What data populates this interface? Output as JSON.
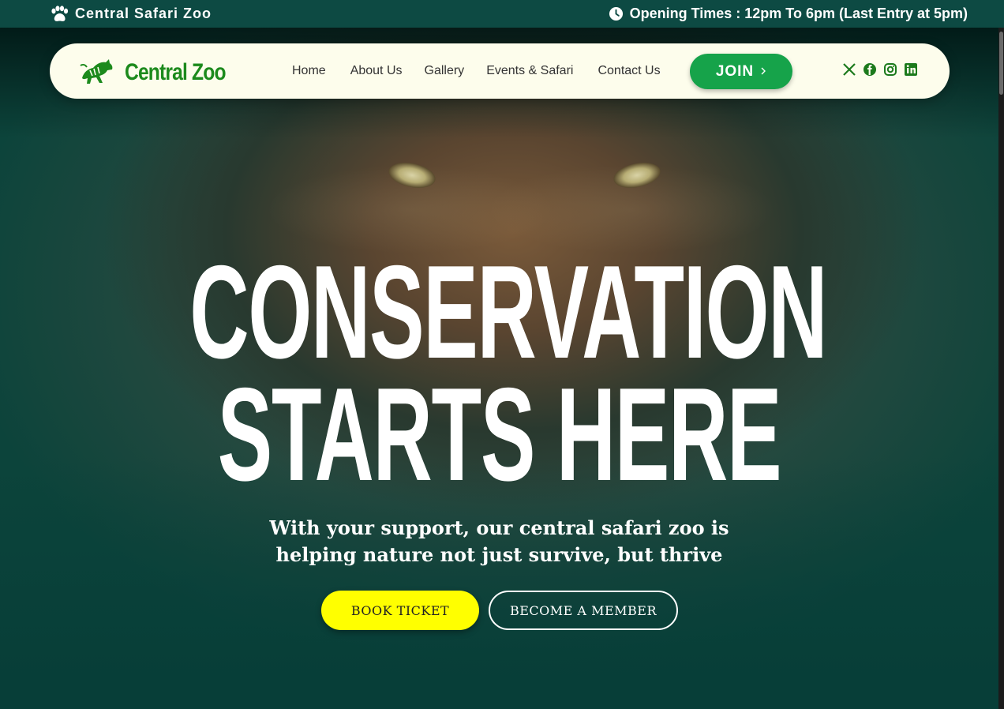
{
  "topbar": {
    "brand": "Central Safari Zoo",
    "hours": "Opening Times : 12pm To 6pm (Last Entry at 5pm)",
    "brand_icon": "paw-icon",
    "hours_icon": "clock-icon"
  },
  "nav": {
    "logo_text": "Central Zoo",
    "logo_icon": "tiger-icon",
    "items": [
      {
        "label": "Home"
      },
      {
        "label": "About Us"
      },
      {
        "label": "Gallery"
      },
      {
        "label": "Events & Safari"
      },
      {
        "label": "Contact Us"
      }
    ],
    "join_label": "JOIN",
    "join_icon": "chevron-right-icon",
    "socials": [
      "x-icon",
      "facebook-icon",
      "instagram-icon",
      "linkedin-icon"
    ]
  },
  "hero": {
    "headline_line1": "CONSERVATION",
    "headline_line2": "STARTS HERE",
    "subtitle_line1": "With your support, our central safari zoo is",
    "subtitle_line2": "helping nature not just survive, but thrive",
    "book_ticket": "BOOK TICKET",
    "become_member": "BECOME A MEMBER"
  },
  "colors": {
    "topbar_bg": "#0d4a43",
    "nav_bg": "#fdfdec",
    "brand_green": "#1c8a1c",
    "join_green": "#16a34a",
    "ticket_yellow": "#ffff00"
  }
}
